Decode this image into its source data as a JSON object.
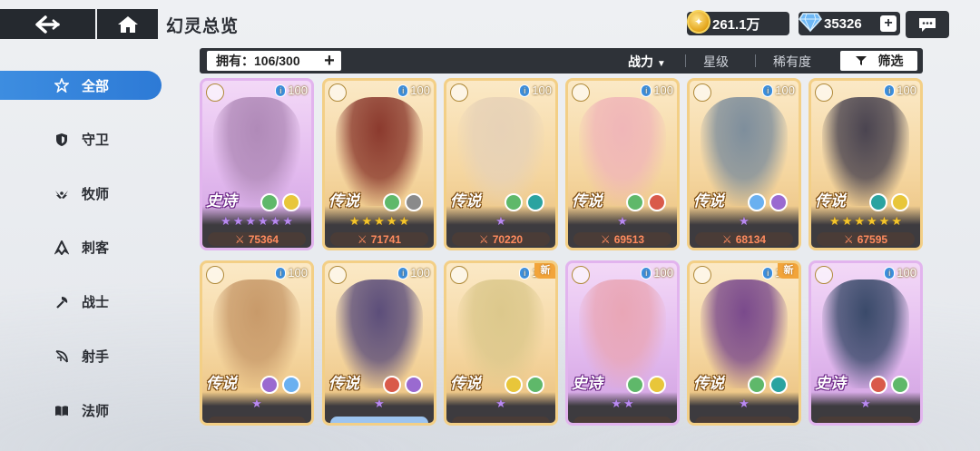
{
  "header": {
    "title": "幻灵总览",
    "gold": "261.1万",
    "gems": "35326"
  },
  "filter": {
    "owned": "拥有：106/300",
    "sort_power": "战力",
    "sort_star": "星级",
    "sort_rarity": "稀有度",
    "filter": "筛选"
  },
  "sidebar": {
    "items": [
      {
        "label": "全部",
        "icon": "star-all-icon"
      },
      {
        "label": "守卫",
        "icon": "shield-icon"
      },
      {
        "label": "牧师",
        "icon": "wings-icon"
      },
      {
        "label": "刺客",
        "icon": "assassin-icon"
      },
      {
        "label": "战士",
        "icon": "axe-icon"
      },
      {
        "label": "射手",
        "icon": "bow-icon"
      },
      {
        "label": "法师",
        "icon": "book-icon"
      }
    ]
  },
  "cards": [
    {
      "rarity": "史诗",
      "level": "100",
      "stars": 6,
      "power": "75364",
      "new": false,
      "epic": true,
      "art": "#b08ab8",
      "elements": [
        "#5fb86a",
        "#e8c63a"
      ]
    },
    {
      "rarity": "传说",
      "level": "100",
      "stars": 5,
      "power": "71741",
      "new": false,
      "epic": false,
      "art": "#8b3a2e",
      "elements": [
        "#5fb86a",
        "#8a8a8a"
      ]
    },
    {
      "rarity": "传说",
      "level": "100",
      "stars": 1,
      "power": "70220",
      "new": false,
      "epic": false,
      "art": "#e7d2b7",
      "elements": [
        "#5fb86a",
        "#2aa3a0"
      ]
    },
    {
      "rarity": "传说",
      "level": "100",
      "stars": 1,
      "power": "69513",
      "new": false,
      "epic": false,
      "art": "#f0b6b8",
      "elements": [
        "#5fb86a",
        "#d95a4a"
      ]
    },
    {
      "rarity": "传说",
      "level": "100",
      "stars": 1,
      "power": "68134",
      "new": false,
      "epic": false,
      "art": "#7e8e9c",
      "elements": [
        "#6ab0f0",
        "#9a6ad0"
      ]
    },
    {
      "rarity": "传说",
      "level": "100",
      "stars": 6,
      "power": "67595",
      "new": false,
      "epic": false,
      "art": "#4a4450",
      "elements": [
        "#2aa3a0",
        "#e8c63a"
      ]
    },
    {
      "rarity": "传说",
      "level": "100",
      "stars": 1,
      "power": "",
      "new": false,
      "epic": false,
      "art": "#c89a6a",
      "elements": [
        "#9a6ad0",
        "#6ab0f0"
      ]
    },
    {
      "rarity": "传说",
      "level": "100",
      "stars": 1,
      "power": "",
      "new": false,
      "epic": false,
      "art": "#5c4e7a",
      "elements": [
        "#d95a4a",
        "#9a6ad0"
      ]
    },
    {
      "rarity": "传说",
      "level": "100",
      "stars": 1,
      "power": "",
      "new": true,
      "epic": false,
      "art": "#dcc88c",
      "elements": [
        "#e8c63a",
        "#5fb86a"
      ]
    },
    {
      "rarity": "史诗",
      "level": "100",
      "stars": 2,
      "power": "",
      "new": false,
      "epic": true,
      "art": "#e9a6b6",
      "elements": [
        "#5fb86a",
        "#e8c63a"
      ]
    },
    {
      "rarity": "传说",
      "level": "100",
      "stars": 1,
      "power": "",
      "new": true,
      "epic": false,
      "art": "#7a4a8c",
      "elements": [
        "#5fb86a",
        "#2aa3a0"
      ]
    },
    {
      "rarity": "史诗",
      "level": "100",
      "stars": 1,
      "power": "",
      "new": false,
      "epic": true,
      "art": "#3a4a6a",
      "elements": [
        "#d95a4a",
        "#5fb86a"
      ]
    }
  ],
  "labels": {
    "new": "新"
  }
}
